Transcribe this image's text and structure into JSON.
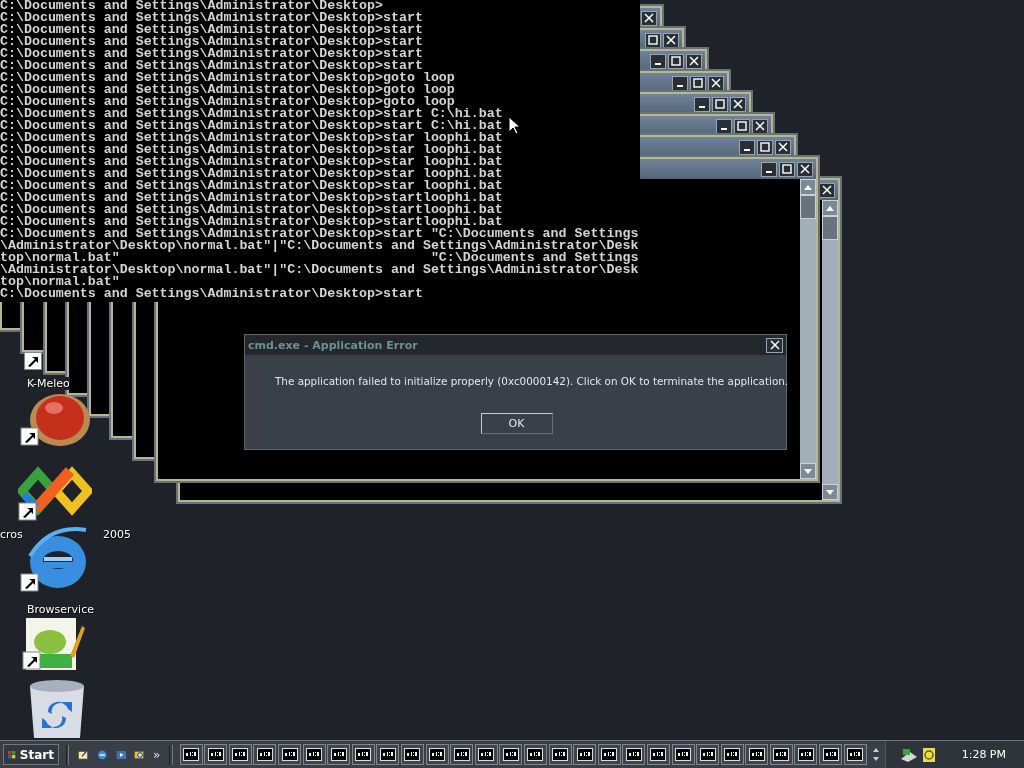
{
  "console": {
    "lines": [
      "C:\\Documents and Settings\\Administrator\\Desktop>",
      "C:\\Documents and Settings\\Administrator\\Desktop>start",
      "C:\\Documents and Settings\\Administrator\\Desktop>start",
      "C:\\Documents and Settings\\Administrator\\Desktop>start",
      "C:\\Documents and Settings\\Administrator\\Desktop>start",
      "C:\\Documents and Settings\\Administrator\\Desktop>start",
      "C:\\Documents and Settings\\Administrator\\Desktop>goto loop",
      "C:\\Documents and Settings\\Administrator\\Desktop>goto loop",
      "C:\\Documents and Settings\\Administrator\\Desktop>goto loop",
      "C:\\Documents and Settings\\Administrator\\Desktop>start C:\\hi.bat",
      "C:\\Documents and Settings\\Administrator\\Desktop>start C:\\hi.bat",
      "C:\\Documents and Settings\\Administrator\\Desktop>star loophi.bat",
      "C:\\Documents and Settings\\Administrator\\Desktop>star loophi.bat",
      "C:\\Documents and Settings\\Administrator\\Desktop>star loophi.bat",
      "C:\\Documents and Settings\\Administrator\\Desktop>star loophi.bat",
      "C:\\Documents and Settings\\Administrator\\Desktop>star loophi.bat",
      "C:\\Documents and Settings\\Administrator\\Desktop>startloophi.bat",
      "C:\\Documents and Settings\\Administrator\\Desktop>startloophi.bat",
      "C:\\Documents and Settings\\Administrator\\Desktop>startloophi.bat",
      "C:\\Documents and Settings\\Administrator\\Desktop>start \"C:\\Documents and Settings",
      "\\Administrator\\Desktop\\normal.bat\"|\"C:\\Documents and Settings\\Administrator\\Desk",
      "top\\normal.bat\"                                       \"C:\\Documents and Settings",
      "\\Administrator\\Desktop\\normal.bat\"|\"C:\\Documents and Settings\\Administrator\\Desk",
      "top\\normal.bat\"",
      "C:\\Documents and Settings\\Administrator\\Desktop>start"
    ]
  },
  "desktop_icons": [
    {
      "kind": "shortcut"
    },
    {
      "kind": "label",
      "text": "K-Meleo"
    },
    {
      "kind": "ball"
    },
    {
      "kind": "knot"
    },
    {
      "kind": "label",
      "text": "cros"
    },
    {
      "kind": "label",
      "text": "2005"
    },
    {
      "kind": "browser"
    },
    {
      "kind": "label",
      "text": "Browservice"
    },
    {
      "kind": "notepad"
    },
    {
      "kind": "recycle"
    }
  ],
  "dialog": {
    "title": "cmd.exe - Application Error",
    "message": "The application failed to initialize properly (0xc0000142). Click on OK to terminate the application.",
    "button": "OK"
  },
  "taskbar": {
    "start": "Start",
    "quick_launch": [
      {
        "kind": "desktop"
      },
      {
        "kind": "browser"
      },
      {
        "kind": "media"
      },
      {
        "kind": "search"
      }
    ],
    "more": "»",
    "tasks": [
      {
        "kind": "console"
      },
      {
        "kind": "console"
      },
      {
        "kind": "console"
      },
      {
        "kind": "console"
      },
      {
        "kind": "console"
      },
      {
        "kind": "console"
      },
      {
        "kind": "console"
      },
      {
        "kind": "console"
      },
      {
        "kind": "console"
      },
      {
        "kind": "console"
      },
      {
        "kind": "console"
      },
      {
        "kind": "console"
      },
      {
        "kind": "console"
      },
      {
        "kind": "console"
      },
      {
        "kind": "console"
      },
      {
        "kind": "console"
      },
      {
        "kind": "console"
      },
      {
        "kind": "console"
      },
      {
        "kind": "console"
      },
      {
        "kind": "console"
      },
      {
        "kind": "console"
      },
      {
        "kind": "console"
      },
      {
        "kind": "console"
      },
      {
        "kind": "console"
      },
      {
        "kind": "console"
      },
      {
        "kind": "console"
      },
      {
        "kind": "console"
      },
      {
        "kind": "console"
      }
    ],
    "clock": "1:28 PM"
  }
}
